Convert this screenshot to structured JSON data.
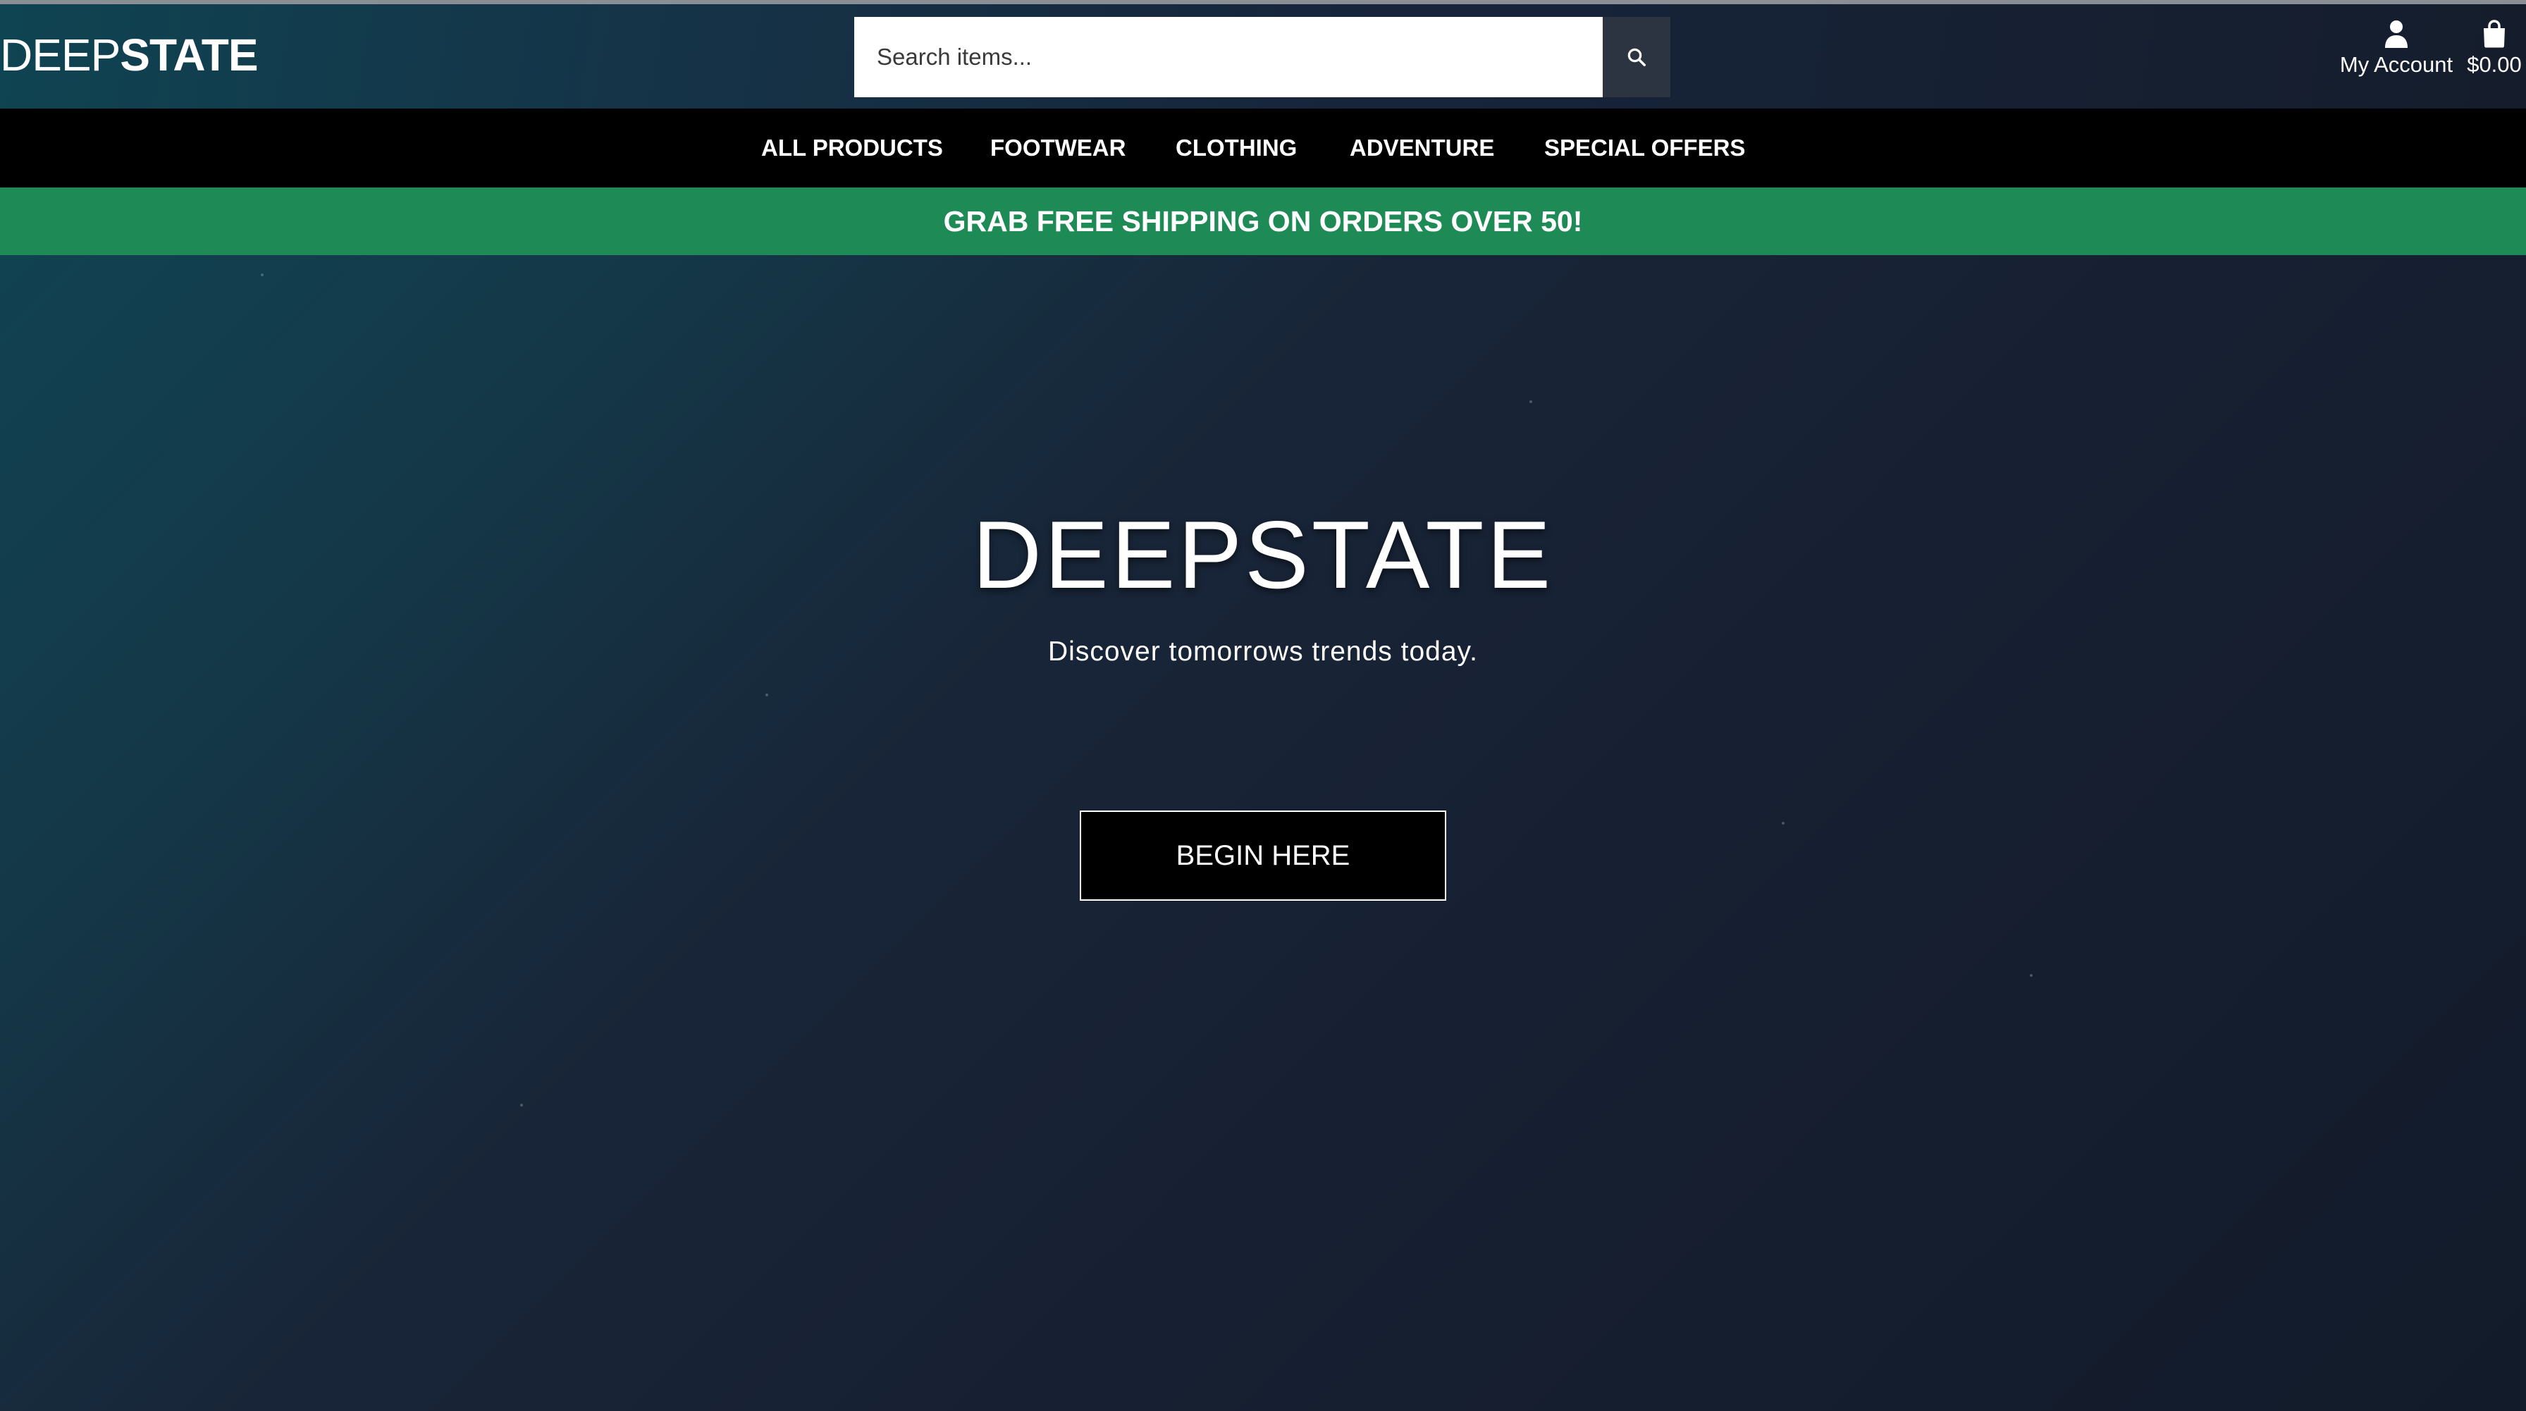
{
  "header": {
    "logo_light": "DEEP",
    "logo_bold": "STATE",
    "search": {
      "placeholder": "Search items...",
      "icon": "search-icon"
    },
    "account": {
      "label": "My Account",
      "icon": "user-icon"
    },
    "cart": {
      "total": "$0.00",
      "icon": "shopping-bag-icon"
    }
  },
  "nav": {
    "items": [
      {
        "label": "ALL PRODUCTS"
      },
      {
        "label": "FOOTWEAR"
      },
      {
        "label": "CLOTHING"
      },
      {
        "label": "ADVENTURE"
      },
      {
        "label": "SPECIAL OFFERS"
      }
    ]
  },
  "promo": {
    "text": "GRAB FREE SHIPPING ON ORDERS OVER 50!",
    "color": "#1e8a55"
  },
  "hero": {
    "title": "DEEPSTATE",
    "subtitle": "Discover tomorrows trends today.",
    "cta_label": "BEGIN HERE"
  },
  "colors": {
    "nav_background": "#000000",
    "promo_background": "#1e8a55",
    "hero_gradient_start": "#114252",
    "hero_gradient_end": "#121b2a"
  }
}
